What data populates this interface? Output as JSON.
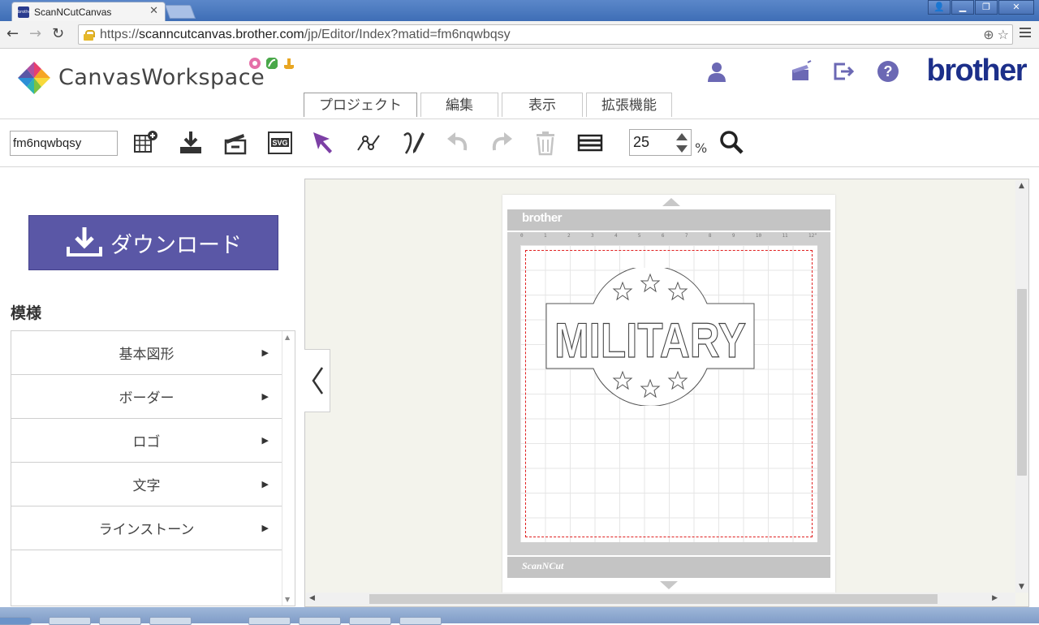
{
  "browser": {
    "tab_title": "ScanNCutCanvas",
    "favicon_label": "brother",
    "url_scheme": "https://",
    "url_host": "scanncutcanvas.brother.com",
    "url_path": "/jp/Editor/Index?matid=fm6nqwbqsy"
  },
  "header": {
    "logo_text": "CanvasWorkspace",
    "brand": "brother",
    "menu_tabs": [
      "プロジェクト",
      "編集",
      "表示",
      "拡張機能"
    ]
  },
  "toolbar": {
    "project_name": "fm6nqwbqsy",
    "zoom_value": "25",
    "zoom_unit": "%"
  },
  "sidebar": {
    "download_label": "ダウンロード",
    "section_title": "模様",
    "items": [
      {
        "label": "基本図形"
      },
      {
        "label": "ボーダー"
      },
      {
        "label": "ロゴ"
      },
      {
        "label": "文字"
      },
      {
        "label": "ラインストーン"
      }
    ]
  },
  "mat": {
    "brand": "brother",
    "footer": "ScanNCut",
    "design_text": "MILITARY",
    "ruler_top": [
      "0",
      "1",
      "2",
      "3",
      "4",
      "5",
      "6",
      "7",
      "8",
      "9",
      "10",
      "11",
      "12\""
    ]
  },
  "colors": {
    "accent_purple": "#5a57a6",
    "brand_blue": "#1c2f8a",
    "icon_purple": "#6b68b4",
    "cut_line": "#e02020"
  }
}
